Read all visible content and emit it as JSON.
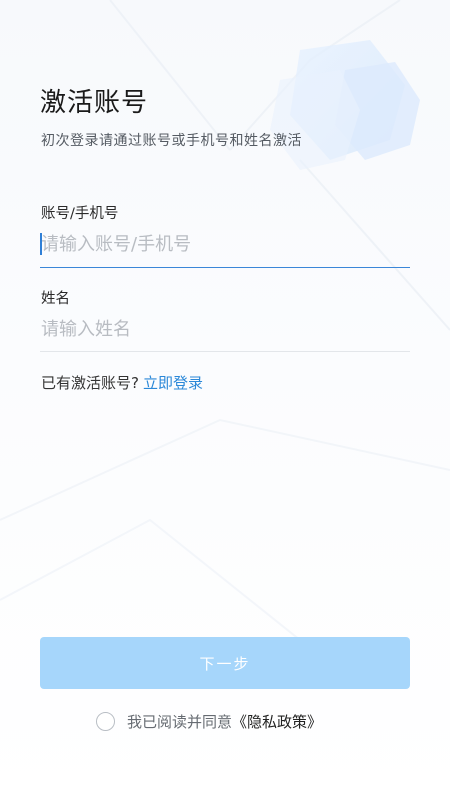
{
  "header": {
    "title": "激活账号",
    "subtitle": "初次登录请通过账号或手机号和姓名激活"
  },
  "form": {
    "account": {
      "label": "账号/手机号",
      "placeholder": "请输入账号/手机号",
      "value": ""
    },
    "name": {
      "label": "姓名",
      "placeholder": "请输入姓名",
      "value": ""
    }
  },
  "login": {
    "prompt": "已有激活账号?",
    "link_label": "立即登录"
  },
  "actions": {
    "next_label": "下一步"
  },
  "agreement": {
    "text": "我已阅读并同意",
    "link_label": "《隐私政策》",
    "checked": false
  },
  "colors": {
    "accent": "#2b88d8",
    "button_disabled": "#a6d6fb",
    "active_underline": "#3a86d8"
  }
}
